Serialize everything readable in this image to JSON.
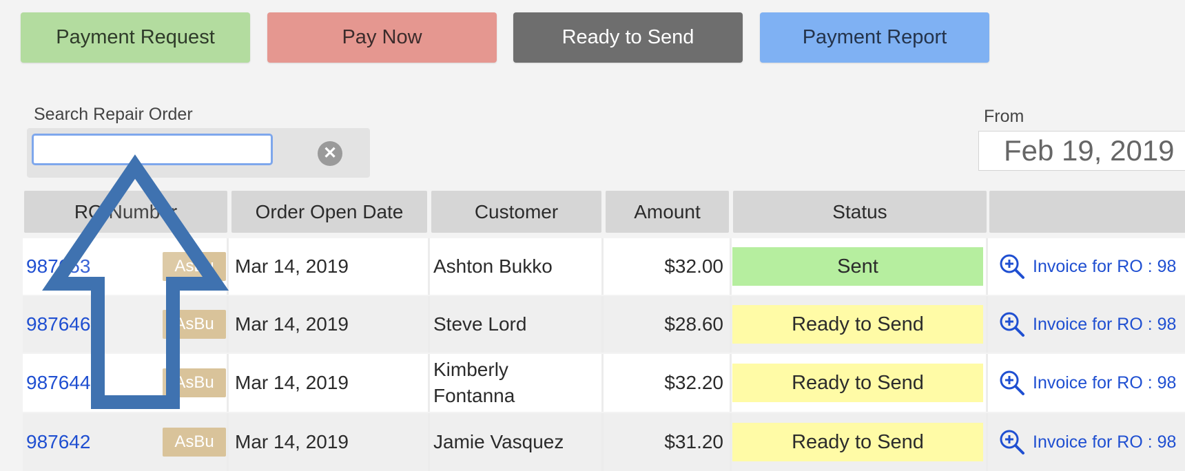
{
  "toolbar": {
    "buttons": [
      {
        "label": "Payment Request",
        "color": "#b3dc9f"
      },
      {
        "label": "Pay Now",
        "color": "#e59790"
      },
      {
        "label": "Ready to Send",
        "color": "#6e6e6e"
      },
      {
        "label": "Payment Report",
        "color": "#7fb1f3"
      }
    ]
  },
  "search": {
    "label": "Search Repair Order",
    "value": "",
    "clear_icon": "clear-circle-icon"
  },
  "date_filter": {
    "from_label": "From",
    "from_value": "Feb 19, 2019"
  },
  "table": {
    "columns": [
      "RO Number",
      "Order Open Date",
      "Customer",
      "Amount",
      "Status",
      ""
    ],
    "rows": [
      {
        "ro": "987653",
        "tag": "AsBu",
        "date": "Mar 14, 2019",
        "customer": "Ashton Bukko",
        "amount": "$32.00",
        "status": "Sent",
        "status_color": "#b6ee9f",
        "invoice": "Invoice for RO : 98"
      },
      {
        "ro": "987646",
        "tag": "AsBu",
        "date": "Mar 14, 2019",
        "customer": "Steve Lord",
        "amount": "$28.60",
        "status": "Ready to Send",
        "status_color": "#fffba6",
        "invoice": "Invoice for RO : 98"
      },
      {
        "ro": "987644",
        "tag": "AsBu",
        "date": "Mar 14, 2019",
        "customer": "Kimberly Fontanna",
        "amount": "$32.20",
        "status": "Ready to Send",
        "status_color": "#fffba6",
        "invoice": "Invoice for RO : 98"
      },
      {
        "ro": "987642",
        "tag": "AsBu",
        "date": "Mar 14, 2019",
        "customer": "Jamie Vasquez",
        "amount": "$31.20",
        "status": "Ready to Send",
        "status_color": "#fffba6",
        "invoice": "Invoice for RO : 98"
      }
    ]
  },
  "annotation": {
    "icon": "blue-up-arrow-overlay",
    "color": "#3f72b0"
  }
}
